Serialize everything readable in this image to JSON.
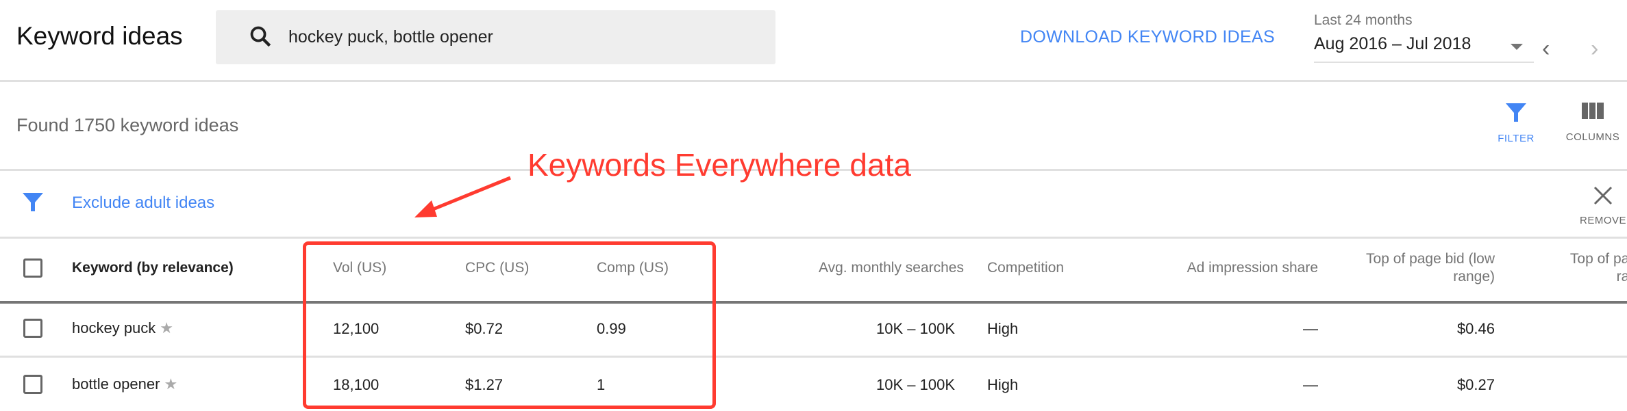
{
  "header": {
    "title": "Keyword ideas",
    "search_value": "hockey puck, bottle opener",
    "download_label": "DOWNLOAD KEYWORD IDEAS",
    "date_range_label": "Last 24 months",
    "date_range_value": "Aug 2016 – Jul 2018"
  },
  "toolbar": {
    "found_text": "Found 1750 keyword ideas",
    "filter_label": "FILTER",
    "columns_label": "COLUMNS"
  },
  "filter_bar": {
    "chip_label": "Exclude adult ideas",
    "remove_label": "REMOVE"
  },
  "annotation": {
    "text": "Keywords Everywhere data",
    "color": "#ff3b30"
  },
  "table": {
    "columns": [
      "Keyword (by relevance)",
      "Vol (US)",
      "CPC (US)",
      "Comp (US)",
      "Avg. monthly searches",
      "Competition",
      "Ad impression share",
      "Top of page bid (low range)",
      "Top of page bid (high range)"
    ],
    "rows": [
      {
        "keyword": "hockey puck",
        "vol": "12,100",
        "cpc": "$0.72",
        "comp": "0.99",
        "avg": "10K – 100K",
        "competition": "High",
        "impression": "—",
        "low_bid": "$0.46"
      },
      {
        "keyword": "bottle opener",
        "vol": "18,100",
        "cpc": "$1.27",
        "comp": "1",
        "avg": "10K – 100K",
        "competition": "High",
        "impression": "—",
        "low_bid": "$0.27"
      }
    ]
  },
  "colors": {
    "accent": "#4285f4",
    "highlight": "#ff3b30"
  }
}
